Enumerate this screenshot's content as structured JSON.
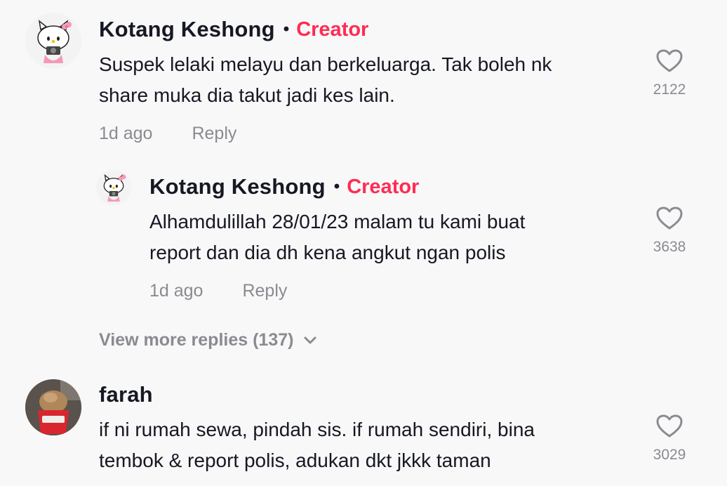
{
  "comments": [
    {
      "username": "Kotang Keshong",
      "badge": "Creator",
      "text": "Suspek lelaki melayu dan berkeluarga. Tak boleh nk\nshare muka dia takut jadi kes lain.",
      "time": "1d ago",
      "reply_label": "Reply",
      "likes": "2122",
      "avatar_icon": "hello-kitty-avatar"
    },
    {
      "username": "Kotang Keshong",
      "badge": "Creator",
      "text": "Alhamdulillah 28/01/23 malam tu kami buat\nreport dan dia dh kena angkut ngan polis",
      "time": "1d ago",
      "reply_label": "Reply",
      "likes": "3638",
      "avatar_icon": "hello-kitty-avatar"
    },
    {
      "username": "farah",
      "text": "if ni rumah sewa, pindah sis. if rumah sendiri, bina\ntembok & report polis, adukan dkt jkkk taman",
      "likes": "3029",
      "avatar_icon": "ice-cream-avatar"
    }
  ],
  "view_more": "View more replies (137)",
  "colors": {
    "creator": "#fe2c55",
    "muted": "#8a8b91",
    "text": "#161823",
    "background": "#f8f8f8"
  }
}
